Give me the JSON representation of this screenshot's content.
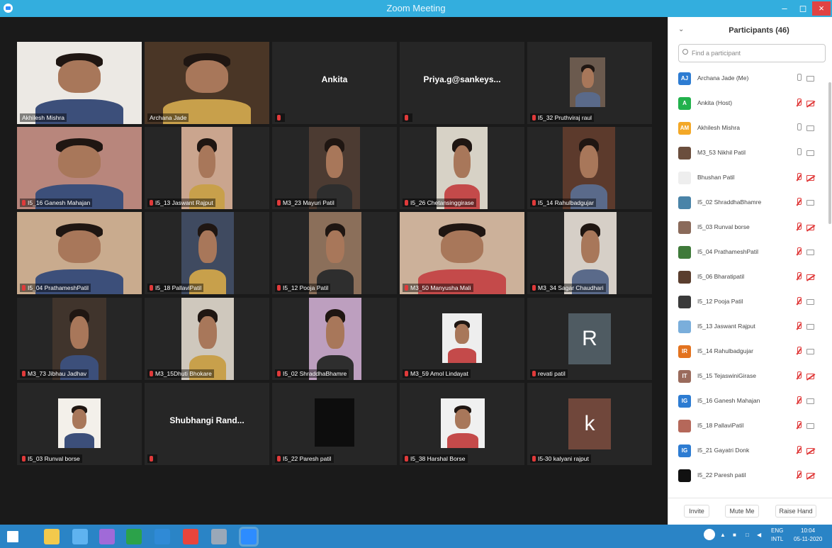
{
  "window": {
    "title": "Zoom Meeting",
    "minimize": "–",
    "maximize": "◻",
    "close": "×"
  },
  "colors": {
    "titlebar": "#33aede",
    "active_speaker": "#cfe55a",
    "muted": "#e03a3a",
    "taskbar": "#2a84c6"
  },
  "gallery": {
    "tiles": [
      {
        "name": "Akhilesh Mishra",
        "type": "video",
        "active": true,
        "muted": false
      },
      {
        "name": "Archana Jade",
        "type": "video",
        "muted": false
      },
      {
        "name": "Ankita",
        "type": "name",
        "muted": true,
        "label": ""
      },
      {
        "name": "Priya.g@sankeys...",
        "type": "name",
        "muted": true,
        "label": ""
      },
      {
        "name": "I5_32 Pruthviraj raul",
        "type": "photo",
        "muted": true
      },
      {
        "name": "I5_16 Ganesh Mahajan",
        "type": "video",
        "muted": true
      },
      {
        "name": "I5_13 Jaswant Rajput",
        "type": "video",
        "muted": true
      },
      {
        "name": "M3_23 Mayuri Patil",
        "type": "video",
        "muted": true
      },
      {
        "name": "I5_26 Chetansinggirase",
        "type": "video",
        "muted": true
      },
      {
        "name": "I5_14 Rahulbadgujar",
        "type": "video",
        "muted": true
      },
      {
        "name": "I5_04 PrathameshPatil",
        "type": "video",
        "muted": true
      },
      {
        "name": "I5_18 PallaviPatil",
        "type": "video",
        "muted": true
      },
      {
        "name": "I5_12 Pooja Patil",
        "type": "video",
        "muted": true
      },
      {
        "name": "M3_50 Manyusha Mali",
        "type": "video",
        "muted": true
      },
      {
        "name": "M3_34 Sagar Chaudhari",
        "type": "video",
        "muted": true
      },
      {
        "name": "M3_73 Jibhau Jadhav",
        "type": "video",
        "muted": true
      },
      {
        "name": "M3_15Dhuti Bhokare",
        "type": "video",
        "muted": true
      },
      {
        "name": "I5_02 ShraddhaBhamre",
        "type": "video",
        "muted": true
      },
      {
        "name": "M3_59 Amol Lindayat",
        "type": "photo",
        "muted": true
      },
      {
        "name": "revati patil",
        "type": "letter",
        "letter": "R",
        "muted": true
      },
      {
        "name": "I5_03 Runval borse",
        "type": "photo",
        "muted": true
      },
      {
        "name": "Shubhangi Rand...",
        "type": "name",
        "muted": true,
        "label": ""
      },
      {
        "name": "I5_22 Paresh patil",
        "type": "black",
        "muted": true
      },
      {
        "name": "I5_38 Harshal Borse",
        "type": "photo",
        "muted": true
      },
      {
        "name": "I5-30 kalyani rajput",
        "type": "letter",
        "letter": "k",
        "muted": true
      }
    ]
  },
  "participants_panel": {
    "title": "Participants (46)",
    "search_placeholder": "Find a participant",
    "people": [
      {
        "initials": "AJ",
        "name": "Archana Jade (Me)",
        "color": "#2d7cd2",
        "mic": "on",
        "cam": "on"
      },
      {
        "initials": "A",
        "name": "Ankita (Host)",
        "color": "#22b14c",
        "mic": "off",
        "cam": "off"
      },
      {
        "initials": "AM",
        "name": "Akhilesh Mishra",
        "color": "#f3a827",
        "mic": "on",
        "cam": "on"
      },
      {
        "initials": "",
        "name": "M3_53 Nikhil Patil",
        "color": "#6b4e3d",
        "mic": "on",
        "cam": "on"
      },
      {
        "initials": "",
        "name": "Bhushan Patil",
        "color": "#eeeeee",
        "mic": "off",
        "cam": "off"
      },
      {
        "initials": "",
        "name": "I5_02 ShraddhaBhamre",
        "color": "#4a84a8",
        "mic": "off",
        "cam": "on"
      },
      {
        "initials": "",
        "name": "I5_03 Runval borse",
        "color": "#8a6a5a",
        "mic": "off",
        "cam": "off"
      },
      {
        "initials": "",
        "name": "I5_04 PrathameshPatil",
        "color": "#3f7a3a",
        "mic": "off",
        "cam": "on"
      },
      {
        "initials": "",
        "name": "I5_06 Bharatipatil",
        "color": "#5a3e2e",
        "mic": "off",
        "cam": "off"
      },
      {
        "initials": "",
        "name": "I5_12 Pooja Patil",
        "color": "#3a3a3a",
        "mic": "off",
        "cam": "on"
      },
      {
        "initials": "",
        "name": "I5_13 Jaswant Rajput",
        "color": "#7aaedb",
        "mic": "off",
        "cam": "on"
      },
      {
        "initials": "IR",
        "name": "I5_14 Rahulbadgujar",
        "color": "#e3731f",
        "mic": "off",
        "cam": "on"
      },
      {
        "initials": "IT",
        "name": "I5_15 TejaswiniGirase",
        "color": "#9a6b5c",
        "mic": "off",
        "cam": "off"
      },
      {
        "initials": "IG",
        "name": "I5_16 Ganesh Mahajan",
        "color": "#2d7cd2",
        "mic": "off",
        "cam": "on"
      },
      {
        "initials": "",
        "name": "I5_18 PallaviPatil",
        "color": "#b5685a",
        "mic": "off",
        "cam": "on"
      },
      {
        "initials": "IG",
        "name": "I5_21 Gayatri Donk",
        "color": "#2d7cd2",
        "mic": "off",
        "cam": "off"
      },
      {
        "initials": "",
        "name": "I5_22 Paresh patil",
        "color": "#111111",
        "mic": "off",
        "cam": "off"
      }
    ],
    "buttons": {
      "invite": "Invite",
      "mute_me": "Mute Me",
      "raise_hand": "Raise Hand"
    }
  },
  "taskbar": {
    "apps": [
      "windows-start-icon",
      "file-explorer-icon",
      "internet-explorer-icon",
      "visual-studio-icon",
      "store-icon",
      "teamviewer-icon",
      "chrome-icon",
      "generic-app-icon",
      "zoom-icon"
    ],
    "lang": "ENG",
    "layout": "INTL",
    "time": "10:04",
    "date": "05-11-2020"
  }
}
